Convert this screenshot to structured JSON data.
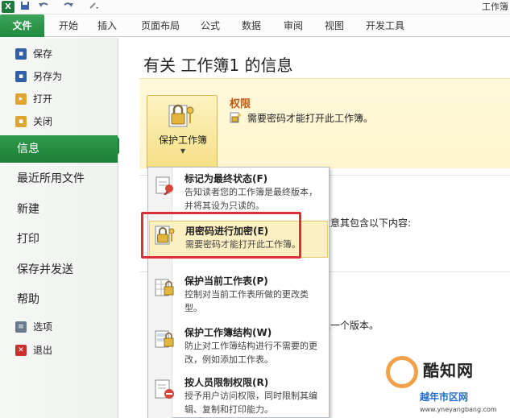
{
  "window": {
    "title": "工作簿"
  },
  "app_icon": "X",
  "quick_access": [
    "save-icon",
    "undo-icon",
    "redo-icon",
    "customize-icon"
  ],
  "ribbon": {
    "tabs": [
      "文件",
      "开始",
      "插入",
      "页面布局",
      "公式",
      "数据",
      "审阅",
      "视图",
      "开发工具"
    ]
  },
  "backstage": {
    "nav_small_top": [
      {
        "label": "保存",
        "icon": "save-icon",
        "color": "#2f5fa6"
      },
      {
        "label": "另存为",
        "icon": "save-as-icon",
        "color": "#2f5fa6"
      },
      {
        "label": "打开",
        "icon": "open-folder-icon",
        "color": "#e0a531"
      },
      {
        "label": "关闭",
        "icon": "close-folder-icon",
        "color": "#e0a531"
      }
    ],
    "nav_big": [
      "信息",
      "最近所用文件",
      "新建",
      "打印",
      "保存并发送",
      "帮助"
    ],
    "nav_small_bottom": [
      {
        "label": "选项",
        "icon": "options-icon",
        "color": "#6b7a8f"
      },
      {
        "label": "退出",
        "icon": "exit-icon",
        "color": "#c9302c"
      }
    ]
  },
  "info": {
    "title": "有关 工作簿1 的信息",
    "permissions": {
      "button_label": "保护工作簿",
      "heading": "权限",
      "description": "需要密码才能打开此工作簿。"
    },
    "bg_texts": [
      "注意其包含以下内容:",
      "上一个版本。"
    ]
  },
  "protect_menu": {
    "items": [
      {
        "title": "标记为最终状态(F)",
        "desc": "告知读者您的工作簿是最终版本，并将其设为只读的。",
        "icon": "mark-final-icon"
      },
      {
        "title": "用密码进行加密(E)",
        "desc": "需要密码才能打开此工作簿。",
        "icon": "encrypt-lock-icon"
      },
      {
        "title": "保护当前工作表(P)",
        "desc": "控制对当前工作表所做的更改类型。",
        "icon": "protect-sheet-icon"
      },
      {
        "title": "保护工作簿结构(W)",
        "desc": "防止对工作簿结构进行不需要的更改，例如添加工作表。",
        "icon": "protect-structure-icon"
      },
      {
        "title": "按人员限制权限(R)",
        "desc": "授予用户访问权限，同时限制其编辑、复制和打印能力。",
        "icon": "restrict-permission-icon"
      }
    ]
  },
  "watermark": {
    "brand": "酷知网",
    "sub": "越年市区网",
    "url": "www.yneyangbang.com"
  },
  "colors": {
    "file_tab": "#1f8a3d",
    "highlight": "#d9303a",
    "perm_heading": "#c05a15"
  }
}
